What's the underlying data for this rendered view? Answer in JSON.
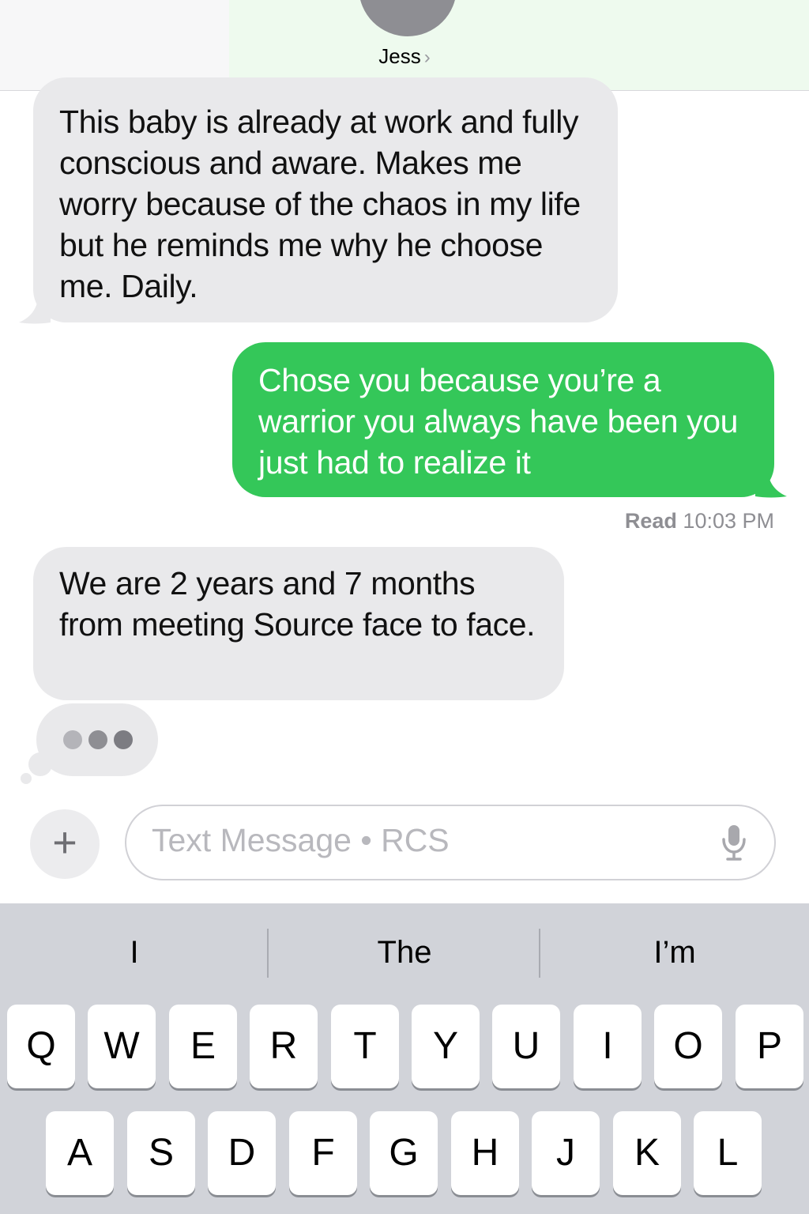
{
  "header": {
    "contact_name": "Jess",
    "chevron": "›"
  },
  "messages": [
    {
      "direction": "incoming",
      "text": "This baby is already at work and fully conscious and aware. Makes me worry because of the chaos in my life but he reminds me why he choose me. Daily."
    },
    {
      "direction": "outgoing",
      "text": "Chose you because you’re a warrior you always have been you just had to realize it"
    },
    {
      "direction": "incoming",
      "text": "We are 2 years and 7 months from meeting Source face to face."
    }
  ],
  "read_receipt": {
    "label": "Read",
    "time": "10:03 PM"
  },
  "composer": {
    "plus": "+",
    "placeholder": "Text Message • RCS"
  },
  "keyboard": {
    "suggestions": [
      "I",
      "The",
      "I’m"
    ],
    "row1": [
      "Q",
      "W",
      "E",
      "R",
      "T",
      "Y",
      "U",
      "I",
      "O",
      "P"
    ],
    "row2": [
      "A",
      "S",
      "D",
      "F",
      "G",
      "H",
      "J",
      "K",
      "L"
    ]
  },
  "colors": {
    "outgoing_bubble": "#34c759",
    "incoming_bubble": "#e9e9eb",
    "keyboard_bg": "#d1d3d9"
  },
  "icons": [
    "chevron-right-icon",
    "plus-icon",
    "microphone-icon",
    "typing-indicator-icon"
  ]
}
